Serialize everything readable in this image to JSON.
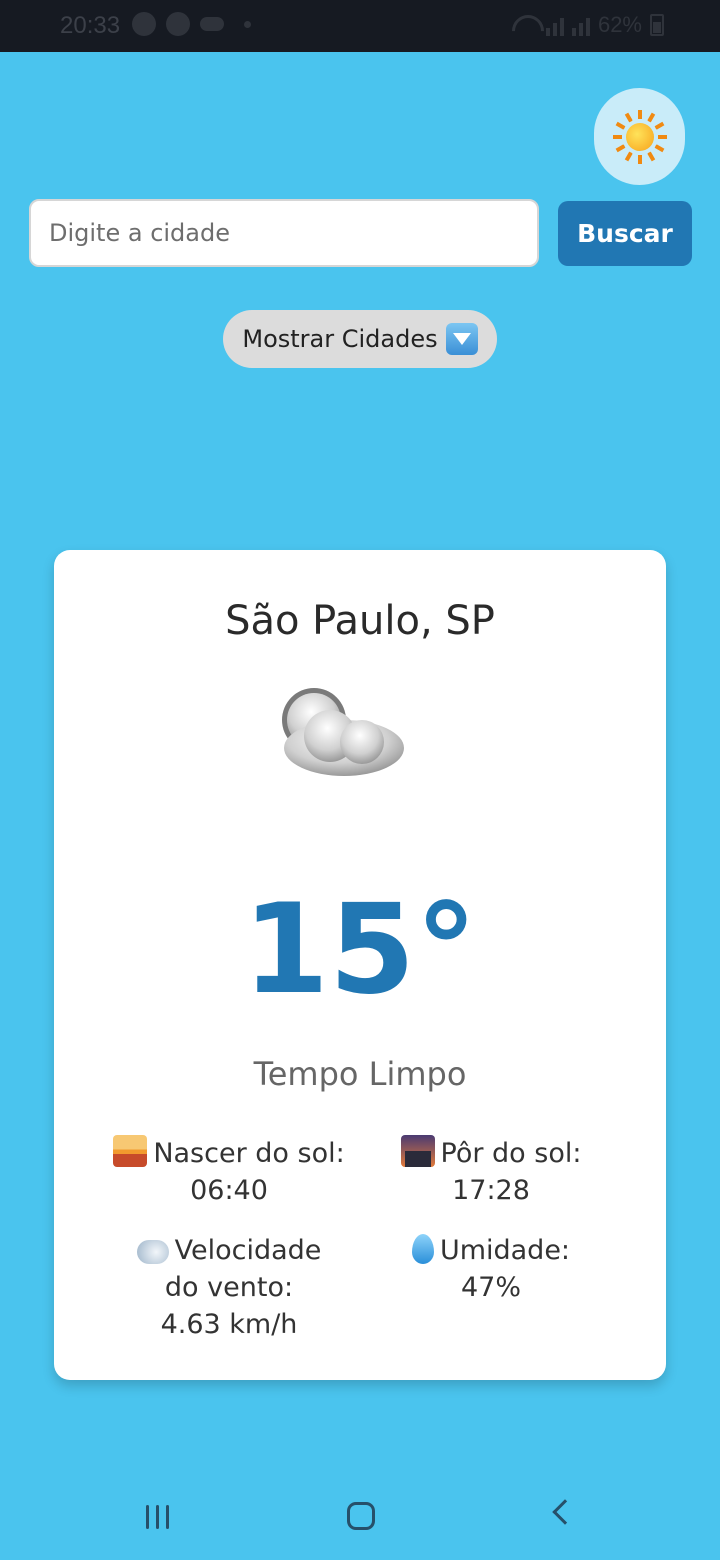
{
  "status_bar": {
    "time": "20:33",
    "battery": "62%"
  },
  "search": {
    "placeholder": "Digite a cidade",
    "value": "",
    "button_label": "Buscar"
  },
  "toggle_cities": {
    "label": "Mostrar Cidades"
  },
  "weather": {
    "city": "São Paulo, SP",
    "icon": "cloudy-icon",
    "temperature": "15°",
    "description": "Tempo Limpo",
    "sunrise_label": "Nascer do sol:",
    "sunrise_value": "06:40",
    "sunset_label": "Pôr do sol:",
    "sunset_value": "17:28",
    "wind_label_line1": "Velocidade",
    "wind_label_line2": "do vento:",
    "wind_value": "4.63 km/h",
    "humidity_label": "Umidade:",
    "humidity_value": "47%"
  },
  "colors": {
    "background": "#4AC4EE",
    "accent": "#2177B3",
    "card": "#FFFFFF"
  }
}
